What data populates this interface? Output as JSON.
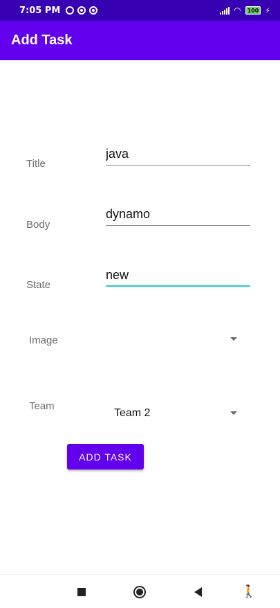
{
  "status_bar": {
    "time": "7:05 PM",
    "battery": "100"
  },
  "app_bar": {
    "title": "Add Task"
  },
  "form": {
    "title_label": "Title",
    "title_value": "java",
    "body_label": "Body",
    "body_value": "dynamo",
    "state_label": "State",
    "state_value": "new",
    "image_label": "Image",
    "image_value": "",
    "team_label": "Team",
    "team_value": "Team 2"
  },
  "actions": {
    "add_task_label": "ADD TASK"
  },
  "colors": {
    "status_bar": "#3700b3",
    "app_bar": "#6200ee",
    "focus_underline": "#26c6da",
    "button": "#6200ee"
  },
  "icons": {
    "status_left": [
      "alarm-icon",
      "sync-icon",
      "notification-icon"
    ],
    "status_right": [
      "signal-icon",
      "wifi-icon",
      "battery-icon",
      "charging-icon"
    ],
    "nav": [
      "recents-icon",
      "home-icon",
      "back-icon",
      "accessibility-icon"
    ]
  }
}
